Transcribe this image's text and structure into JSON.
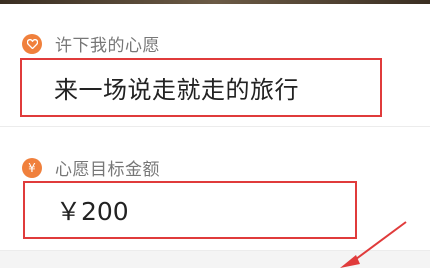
{
  "wish_field": {
    "icon": "heart-icon",
    "label": "许下我的心愿",
    "value": "来一场说走就走的旅行"
  },
  "amount_field": {
    "icon": "yen-icon",
    "icon_glyph": "¥",
    "label": "心愿目标金额",
    "value": "￥200"
  },
  "colors": {
    "accent": "#f0803c",
    "highlight_box": "#e03b3b"
  }
}
